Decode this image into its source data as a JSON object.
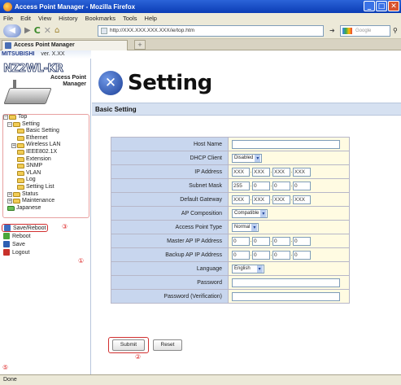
{
  "window": {
    "title": "Access Point Manager - Mozilla Firefox",
    "buttons": {
      "minimize": "_",
      "maximize": "□",
      "close": "✕"
    }
  },
  "menu": [
    "File",
    "Edit",
    "View",
    "History",
    "Bookmarks",
    "Tools",
    "Help"
  ],
  "nav": {
    "url": "http://XXX.XXX.XXX.XXX/ie/top.htm",
    "search_placeholder": "Google"
  },
  "tab": {
    "title": "Access Point Manager",
    "new_tab": "+"
  },
  "sidebar": {
    "brand": "MITSUBISHI",
    "version": "ver. X.XX",
    "model": "NZ2WL-KR",
    "product_line1": "Access Point",
    "product_line2": "Manager",
    "tree": {
      "top": "Top",
      "setting": "Setting",
      "basic_setting": "Basic Setting",
      "ethernet": "Ethernet",
      "wireless_lan": "Wireless LAN",
      "ieee8021x": "IEEE802.1X",
      "extension": "Extension",
      "snmp": "SNMP",
      "vlan": "VLAN",
      "log": "Log",
      "setting_list": "Setting List",
      "status": "Status",
      "maintenance": "Maintenance",
      "japanese": "Japanese"
    },
    "actions": {
      "save_reboot": "Save/Reboot",
      "reboot": "Reboot",
      "save": "Save",
      "logout": "Logout"
    }
  },
  "annotations": {
    "c1": "①",
    "c2": "②",
    "c3": "③",
    "c5": "⑤"
  },
  "main": {
    "title": "Setting",
    "section": "Basic Setting",
    "fields": {
      "host_name": "Host Name",
      "dhcp_client": "DHCP Client",
      "dhcp_value": "Disabled",
      "ip_address": "IP Address",
      "ip_value": [
        "XXX",
        "XXX",
        "XXX",
        "XXX"
      ],
      "subnet_mask": "Subnet Mask",
      "subnet_value": [
        "255",
        "0",
        "0",
        "0"
      ],
      "default_gateway": "Default Gateway",
      "gateway_value": [
        "XXX",
        "XXX",
        "XXX",
        "XXX"
      ],
      "ap_composition": "AP Composition",
      "ap_composition_value": "Compatible",
      "ap_type": "Access Point Type",
      "ap_type_value": "Normal",
      "master_ap": "Master AP IP Address",
      "master_value": [
        "0",
        "0",
        "0",
        "0"
      ],
      "backup_ap": "Backup AP IP Address",
      "backup_value": [
        "0",
        "0",
        "0",
        "0"
      ],
      "language": "Language",
      "language_value": "English",
      "password": "Password",
      "password_verify": "Password (Verification)"
    },
    "submit": "Submit",
    "reset": "Reset"
  },
  "status": "Done"
}
